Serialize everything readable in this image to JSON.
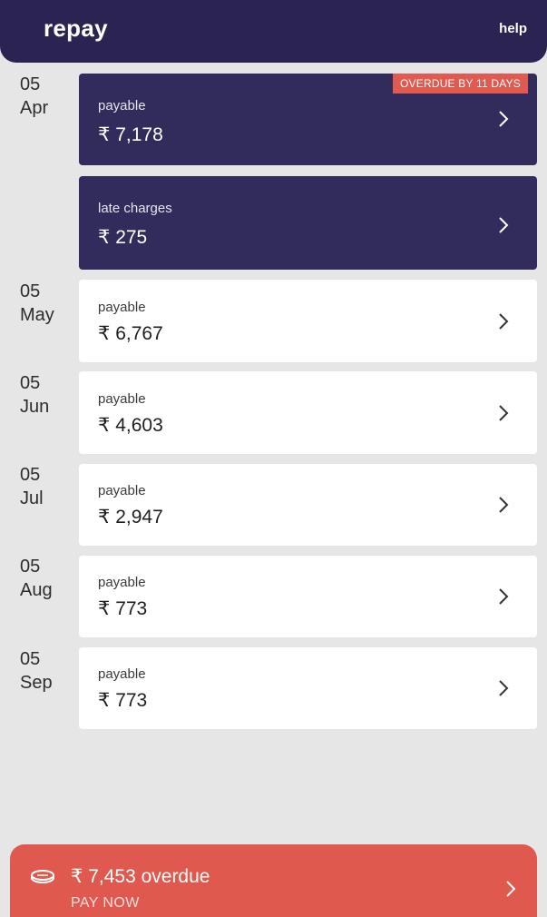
{
  "header": {
    "title": "repay",
    "help": "help"
  },
  "schedule": [
    {
      "day": "05",
      "month": "Apr",
      "label": "payable",
      "amount": "₹ 7,178",
      "badge": "OVERDUE BY 11 DAYS"
    },
    {
      "label": "late charges",
      "amount": "₹ 275"
    },
    {
      "day": "05",
      "month": "May",
      "label": "payable",
      "amount": "₹ 6,767"
    },
    {
      "day": "05",
      "month": "Jun",
      "label": "payable",
      "amount": "₹ 4,603"
    },
    {
      "day": "05",
      "month": "Jul",
      "label": "payable",
      "amount": "₹ 2,947"
    },
    {
      "day": "05",
      "month": "Aug",
      "label": "payable",
      "amount": "₹ 773"
    },
    {
      "day": "05",
      "month": "Sep",
      "label": "payable",
      "amount": "₹ 773"
    }
  ],
  "footer": {
    "overdue": "₹ 7,453 overdue",
    "action": "PAY NOW"
  },
  "icons": {
    "row_arrow": "chevron-right-icon",
    "footer_coin": "coin-icon"
  },
  "colors": {
    "header": "#2b2452",
    "dark_card": "#322c5c",
    "accent": "#e05a4f",
    "background": "#e6e6e6"
  }
}
